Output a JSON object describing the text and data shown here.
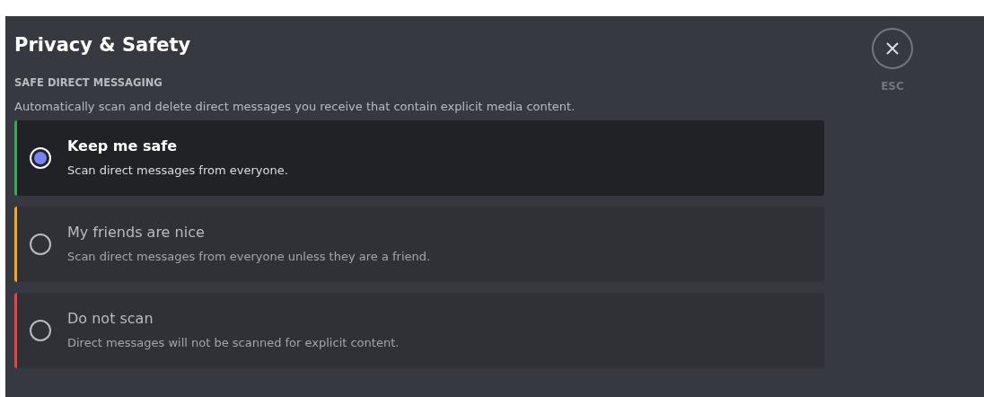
{
  "title": "Privacy & Safety",
  "section": {
    "heading": "SAFE DIRECT MESSAGING",
    "description": "Automatically scan and delete direct messages you receive that contain explicit media content.",
    "options": [
      {
        "label": "Keep me safe",
        "detail": "Scan direct messages from everyone.",
        "selected": true,
        "color": "#3ba55c"
      },
      {
        "label": "My friends are nice",
        "detail": "Scan direct messages from everyone unless they are a friend.",
        "selected": false,
        "color": "#faa61a"
      },
      {
        "label": "Do not scan",
        "detail": "Direct messages will not be scanned for explicit content.",
        "selected": false,
        "color": "#ed4245"
      }
    ]
  },
  "close": {
    "label": "ESC"
  }
}
